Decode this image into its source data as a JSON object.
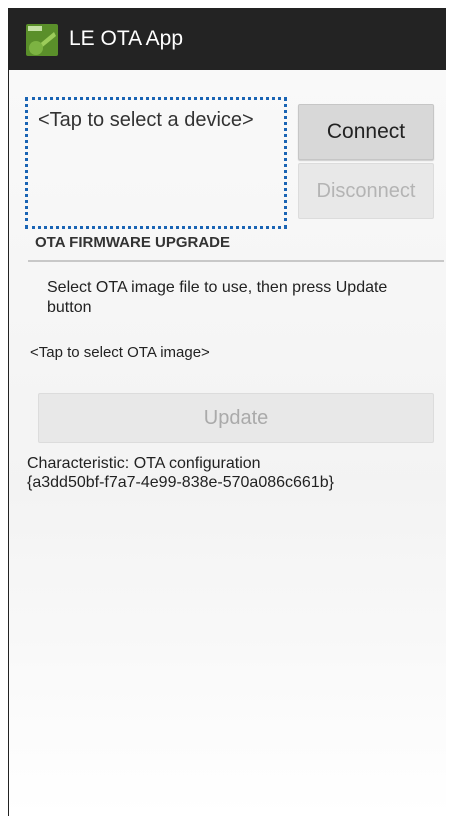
{
  "action_bar": {
    "app_icon": "android-app-icon",
    "title": "LE OTA App",
    "background_color": "#232323"
  },
  "device": {
    "selector_text": "<Tap to select a device>",
    "selector_border_color": "#1a64b4"
  },
  "buttons": {
    "connect_label": "Connect",
    "disconnect_label": "Disconnect",
    "update_label": "Update"
  },
  "ota": {
    "section_header": "OTA FIRMWARE UPGRADE",
    "instruction": "Select OTA image file to use, then press Update button",
    "image_selector_text": "<Tap to select OTA image>"
  },
  "characteristic": {
    "label": "Characteristic: OTA configuration",
    "uuid": "{a3dd50bf-f7a7-4e99-838e-570a086c661b}"
  }
}
